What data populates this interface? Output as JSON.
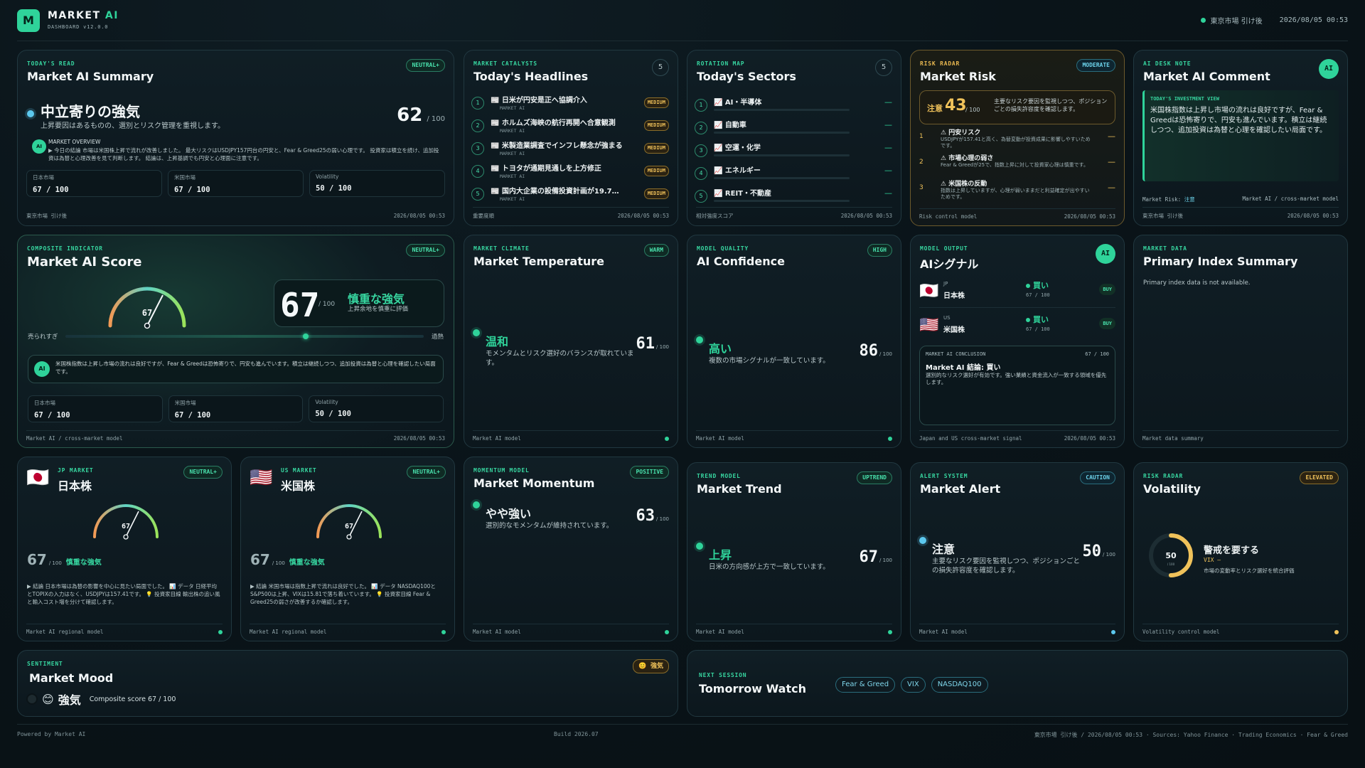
{
  "header": {
    "brand_a": "MARKET",
    "brand_b": "AI",
    "subtitle": "DASHBOARD v12.0.0",
    "logo": "M",
    "status": "東京市場 引け後",
    "datetime": "2026/08/05 00:53"
  },
  "summary": {
    "kicker": "TODAY'S READ",
    "title": "Market AI Summary",
    "badge": "NEUTRAL+",
    "mood": "中立寄りの強気",
    "sub": "上昇要因はあるものの、選別とリスク管理を重視します。",
    "score": "62",
    "score_max": "/ 100",
    "overview_label": "MARKET OVERVIEW",
    "overview_text": "▶ 今日の結論 市場は米国株上昇で流れが改善しました。 最大リスクはUSDJPY157円台の円安と、Fear & Greed25の弱い心理です。 投資家は積立を続け、追加投資は為替と心理改善を見て判断します。 結論は、上昇基調でも円安と心理面に注意です。",
    "ai_avatar": "AI",
    "boxes": [
      {
        "label": "日本市場",
        "value": "67 / 100"
      },
      {
        "label": "米国市場",
        "value": "67 / 100"
      },
      {
        "label": "Volatility",
        "value": "50 / 100"
      }
    ],
    "footer_left": "東京市場 引け後",
    "footer_right": "2026/08/05 00:53"
  },
  "headlines": {
    "kicker": "MARKET CATALYSTS",
    "title": "Today's Headlines",
    "count": "5",
    "items": [
      {
        "num": "1",
        "text": "📰 日米が円安是正へ協調介入",
        "src": "MARKET AI",
        "tag": "MEDIUM"
      },
      {
        "num": "2",
        "text": "📰 ホルムズ海峡の航行再開へ合意観測",
        "src": "MARKET AI",
        "tag": "MEDIUM"
      },
      {
        "num": "3",
        "text": "📰 米製造業調査でインフレ懸念が強まる",
        "src": "MARKET AI",
        "tag": "MEDIUM"
      },
      {
        "num": "4",
        "text": "📰 トヨタが通期見通しを上方修正",
        "src": "MARKET AI",
        "tag": "MEDIUM"
      },
      {
        "num": "5",
        "text": "📰 国内大企業の設備投資計画が19.7…",
        "src": "MARKET AI",
        "tag": "MEDIUM"
      }
    ],
    "footer_left": "重要度順",
    "footer_right": "2026/08/05 00:53"
  },
  "sectors": {
    "kicker": "ROTATION MAP",
    "title": "Today's Sectors",
    "count": "5",
    "items": [
      {
        "num": "1",
        "text": "📈 AI・半導体",
        "dash": "—"
      },
      {
        "num": "2",
        "text": "📈 自動車",
        "dash": "—"
      },
      {
        "num": "3",
        "text": "📈 空運・化学",
        "dash": "—"
      },
      {
        "num": "4",
        "text": "📈 エネルギー",
        "dash": "—"
      },
      {
        "num": "5",
        "text": "📈 REIT・不動産",
        "dash": "—"
      }
    ],
    "footer_left": "相対強度スコア",
    "footer_right": "2026/08/05 00:53"
  },
  "risk": {
    "kicker": "RISK RADAR",
    "title": "Market Risk",
    "badge": "MODERATE",
    "level": "注意",
    "score": "43",
    "score_max": "/ 100",
    "desc": "主要なリスク要因を監視しつつ、ポジションごとの損失許容度を確認します。",
    "items": [
      {
        "num": "1",
        "title": "⚠ 円安リスク",
        "text": "USDJPYが157.41と高く、為替変動が投資成果に影響しやすいためです。",
        "dash": "—"
      },
      {
        "num": "2",
        "title": "⚠ 市場心理の弱さ",
        "text": "Fear & Greedが25で、指数上昇に対して投資家心理は慎重です。",
        "dash": "—"
      },
      {
        "num": "3",
        "title": "⚠ 米国株の反動",
        "text": "指数は上昇していますが、心理が弱いままだと利益確定が出やすいためです。",
        "dash": "—"
      }
    ],
    "footer_left": "Risk control model",
    "footer_right": "2026/08/05 00:53"
  },
  "comment": {
    "kicker": "AI DESK NOTE",
    "title": "Market AI Comment",
    "avatar": "AI",
    "view_label": "TODAY'S INVESTMENT VIEW",
    "text": "米国株指数は上昇し市場の流れは良好ですが、Fear & Greedは恐怖寄りで、円安も進んでいます。積立は継続しつつ、追加投資は為替と心理を確認したい局面です。",
    "risk_label": "Market Risk:",
    "risk_value": "注意",
    "model": "Market AI / cross-market model",
    "footer_left": "東京市場 引け後",
    "footer_right": "2026/08/05 00:53"
  },
  "score": {
    "kicker": "COMPOSITE INDICATOR",
    "title": "Market AI Score",
    "badge": "NEUTRAL+",
    "value": "67",
    "value_max": "/ 100",
    "gauge_label": "67",
    "label": "慎重な強気",
    "sub": "上昇余地を慎重に評価",
    "left": "売られすぎ",
    "right": "過熱",
    "position": 0.67,
    "note": "米国株指数は上昇し市場の流れは良好ですが、Fear & Greedは恐怖寄りで、円安も進んでいます。積立は継続しつつ、追加投資は為替と心理を確認したい局面です。",
    "avatar": "AI",
    "boxes": [
      {
        "label": "日本市場",
        "value": "67 / 100"
      },
      {
        "label": "米国市場",
        "value": "67 / 100"
      },
      {
        "label": "Volatility",
        "value": "50 / 100"
      }
    ],
    "footer_left": "Market AI / cross-market model",
    "footer_right": "2026/08/05 00:53"
  },
  "temperature": {
    "kicker": "MARKET CLIMATE",
    "title": "Market Temperature",
    "badge": "WARM",
    "mood": "温和",
    "desc": "モメンタムとリスク選好のバランスが取れています。",
    "value": "61",
    "max": "/ 100",
    "footer": "Market AI model"
  },
  "confidence": {
    "kicker": "MODEL QUALITY",
    "title": "AI Confidence",
    "badge": "HIGH",
    "mood": "高い",
    "desc": "複数の市場シグナルが一致しています。",
    "value": "86",
    "max": "/ 100",
    "footer": "Market AI model"
  },
  "signal": {
    "kicker": "MODEL OUTPUT",
    "title": "AIシグナル",
    "avatar": "AI",
    "rows": [
      {
        "flag": "🇯🇵",
        "code": "JP",
        "name": "日本株",
        "signal": "買い",
        "score": "67 / 100",
        "tag": "BUY"
      },
      {
        "flag": "🇺🇸",
        "code": "US",
        "name": "米国株",
        "signal": "買い",
        "score": "67 / 100",
        "tag": "BUY"
      }
    ],
    "conclusion_label": "MARKET AI CONCLUSION",
    "conclusion_score": "67 / 100",
    "conclusion_title": "Market AI 結論: 買い",
    "conclusion_text": "選別的なリスク選好が有効です。強い業績と資金流入が一致する領域を優先します。",
    "footer_left": "Japan and US cross-market signal",
    "footer_right": "2026/08/05 00:53"
  },
  "index": {
    "kicker": "MARKET DATA",
    "title": "Primary Index Summary",
    "text": "Primary index data is not available.",
    "footer": "Market data summary"
  },
  "jp": {
    "kicker": "JP MARKET",
    "flag": "🇯🇵",
    "title": "日本株",
    "badge": "NEUTRAL+",
    "gauge": "67",
    "value": "67",
    "max": "/ 100",
    "label": "慎重な強気",
    "text": "▶ 結論 日本市場は為替の影響を中心に見たい局面でした。 📊 データ 日経平均とTOPIXの入力はなく、USDJPYは157.41です。 💡 投資家目線 輸出株の追い風と輸入コスト増を分けて確認します。",
    "footer": "Market AI regional model"
  },
  "us": {
    "kicker": "US MARKET",
    "flag": "🇺🇸",
    "title": "米国株",
    "badge": "NEUTRAL+",
    "gauge": "67",
    "value": "67",
    "max": "/ 100",
    "label": "慎重な強気",
    "text": "▶ 結論 米国市場は指数上昇で流れは良好でした。 📊 データ NASDAQ100とS&P500は上昇、VIXは15.81で落ち着いています。 💡 投資家目線 Fear & Greed25の弱さが改善するか確認します。",
    "footer": "Market AI regional model"
  },
  "momentum": {
    "kicker": "MOMENTUM MODEL",
    "title": "Market Momentum",
    "badge": "POSITIVE",
    "mood": "やや強い",
    "desc": "選別的なモメンタムが維持されています。",
    "value": "63",
    "max": "/ 100",
    "footer": "Market AI model"
  },
  "trend": {
    "kicker": "TREND MODEL",
    "title": "Market Trend",
    "badge": "UPTREND",
    "mood": "上昇",
    "desc": "日米の方向感が上方で一致しています。",
    "value": "67",
    "max": "/ 100",
    "footer": "Market AI model"
  },
  "alert": {
    "kicker": "ALERT SYSTEM",
    "title": "Market Alert",
    "badge": "CAUTION",
    "mood": "注意",
    "desc": "主要なリスク要因を監視しつつ、ポジションごとの損失許容度を確認します。",
    "value": "50",
    "max": "/ 100",
    "footer": "Market AI model"
  },
  "volatility": {
    "kicker": "RISK RADAR",
    "title": "Volatility",
    "badge": "ELEVATED",
    "value": "50",
    "ring_sub": "/ 100",
    "level": 0.5,
    "label": "警戒を要する",
    "vix": "VIX —",
    "desc": "市場の変動率とリスク選好を統合評価",
    "footer": "Volatility control model"
  },
  "mood": {
    "kicker": "SENTIMENT",
    "title": "Market Mood",
    "badge": "😊 強気",
    "emoji": "😊",
    "label": "強気",
    "score_text": "Composite score 67 / 100"
  },
  "tomorrow": {
    "kicker": "NEXT SESSION",
    "title": "Tomorrow Watch",
    "chips": [
      "Fear & Greed",
      "VIX",
      "NASDAQ100"
    ]
  },
  "footer": {
    "left": "Powered by Market AI",
    "center": "Build 2026.07",
    "right": "東京市場 引け後 / 2026/08/05 00:53 · Sources: Yahoo Finance · Trading Economics · Fear & Greed"
  },
  "colors": {
    "accent": "#2fd39a",
    "amber": "#f0c25a",
    "cyan": "#6cd2ea",
    "background": "#0a1419"
  }
}
